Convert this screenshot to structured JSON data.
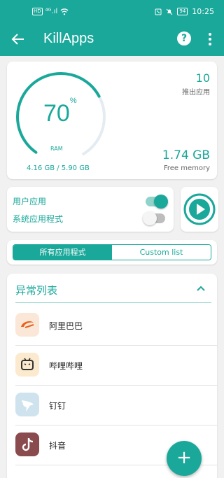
{
  "status_bar": {
    "hd": "HD",
    "signal": "⁴ᴳ.ıl",
    "battery": "94",
    "time": "10:25"
  },
  "app_bar": {
    "title": "KillApps",
    "help_label": "?"
  },
  "ram": {
    "percent": "70",
    "percent_sign": "%",
    "percent_value": 70,
    "label": "RAM",
    "usage": "4.16 GB / 5.90 GB",
    "killed_count": "10",
    "killed_label": "推出应用",
    "free_value": "1.74 GB",
    "free_label": "Free memory"
  },
  "toggles": {
    "user_apps": {
      "label": "用户应用",
      "on": true
    },
    "system_apps": {
      "label": "系统应用程式",
      "on": false
    }
  },
  "segments": {
    "all": "所有应用程式",
    "custom": "Custom list"
  },
  "list": {
    "title": "异常列表",
    "items": [
      {
        "name": "阿里巴巴",
        "icon": "alibaba-icon"
      },
      {
        "name": "哔哩哔哩",
        "icon": "bilibili-icon"
      },
      {
        "name": "钉钉",
        "icon": "dingtalk-icon"
      },
      {
        "name": "抖音",
        "icon": "douyin-icon"
      }
    ]
  },
  "fab_label": "+",
  "colors": {
    "accent": "#1aa89a",
    "background": "#f1f1f1"
  }
}
